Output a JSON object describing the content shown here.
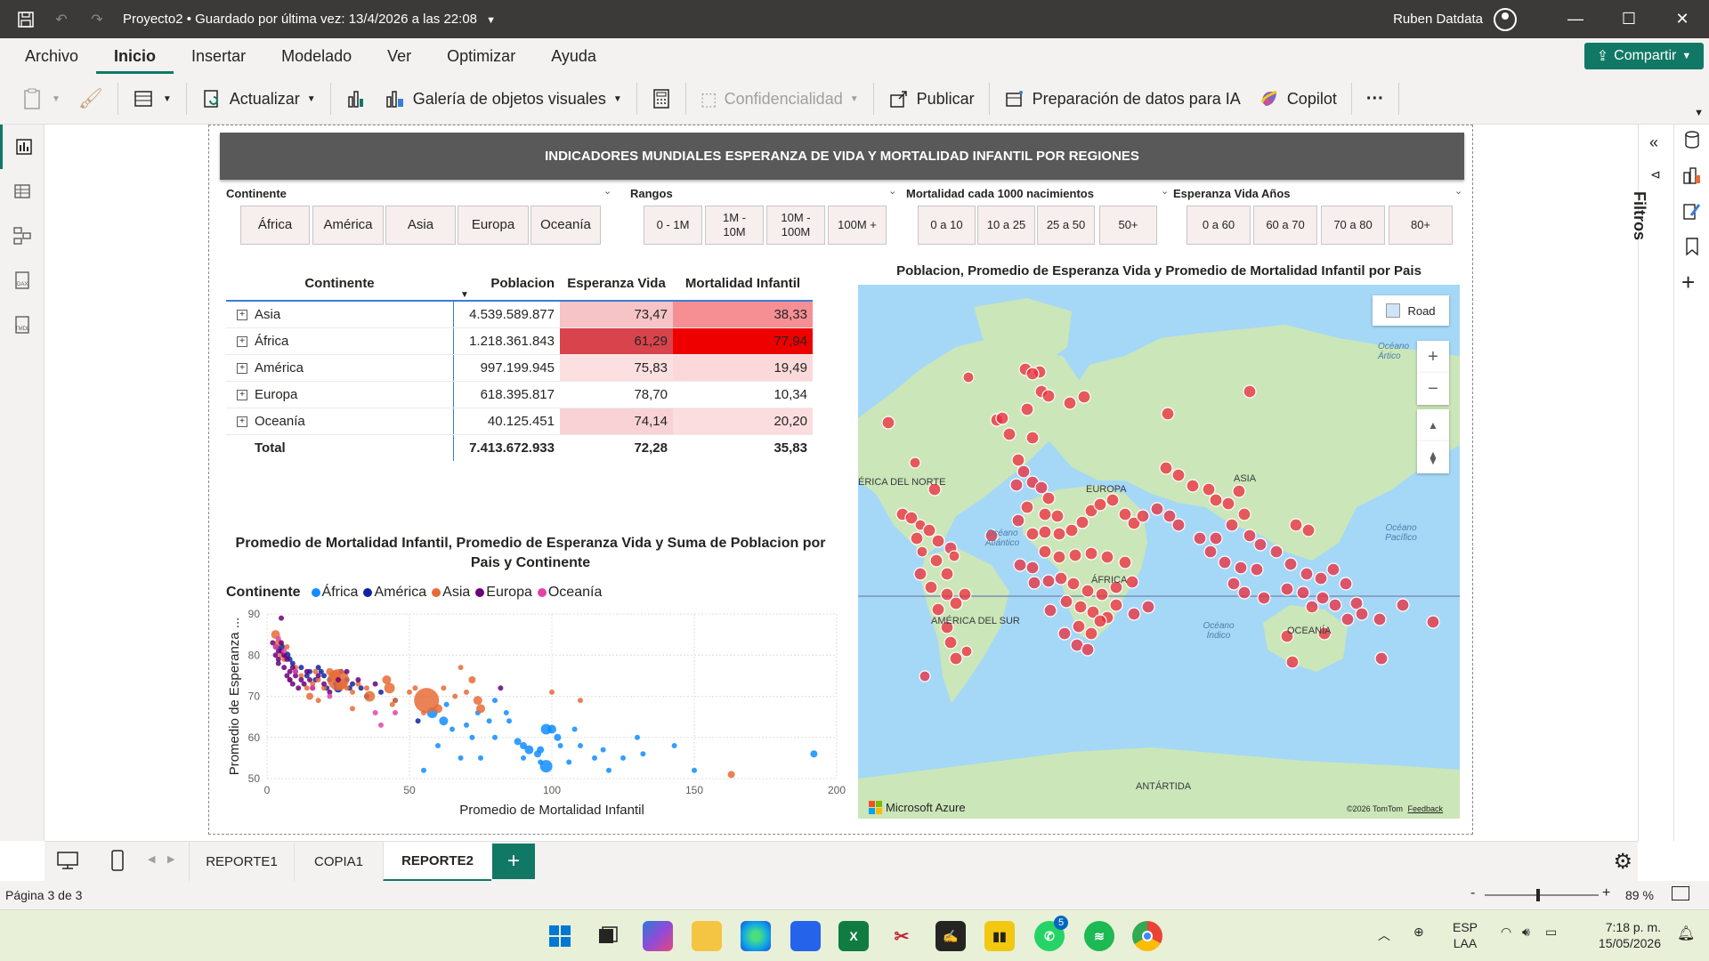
{
  "title_bar": {
    "doc_title": "Proyecto2 • Guardado por última vez: 13/4/2026 a las 22:08",
    "user": "Ruben Datdata"
  },
  "menu": {
    "items": [
      "Archivo",
      "Inicio",
      "Insertar",
      "Modelado",
      "Ver",
      "Optimizar",
      "Ayuda"
    ],
    "active": "Inicio",
    "share": "Compartir"
  },
  "ribbon": {
    "actualizar": "Actualizar",
    "galeria": "Galería de objetos visuales",
    "confidencialidad": "Confidencialidad",
    "publicar": "Publicar",
    "preparacion": "Preparación de datos para IA",
    "copilot": "Copilot",
    "more": "···"
  },
  "right_pane": {
    "filtros": "Filtros"
  },
  "report": {
    "header": "INDICADORES MUNDIALES ESPERANZA DE VIDA Y MORTALIDAD INFANTIL POR REGIONES",
    "slicers": [
      {
        "title": "Continente",
        "options": [
          "África",
          "América",
          "Asia",
          "Europa",
          "Oceanía"
        ]
      },
      {
        "title": "Rangos",
        "options": [
          "0 - 1M",
          "1M - 10M",
          "10M - 100M",
          "100M +"
        ]
      },
      {
        "title": "Mortalidad cada 1000 nacimientos",
        "options": [
          "0 a 10",
          "10 a 25",
          "25 a 50",
          "50+"
        ]
      },
      {
        "title": "Esperanza Vida Años",
        "options": [
          "0 a 60",
          "60 a 70",
          "70 a 80",
          "80+"
        ]
      }
    ],
    "matrix": {
      "headers": [
        "Continente",
        "Poblacion",
        "Esperanza Vida",
        "Mortalidad Infantil"
      ],
      "rows": [
        {
          "name": "Asia",
          "poblacion": "4.539.589.877",
          "esperanza": "73,47",
          "mortalidad": "38,33",
          "esp_bg": "#f6c3c6",
          "mort_bg": "#f58f94"
        },
        {
          "name": "África",
          "poblacion": "1.218.361.843",
          "esperanza": "61,29",
          "mortalidad": "77,94",
          "esp_bg": "#d9434b",
          "mort_bg": "#ee0000"
        },
        {
          "name": "América",
          "poblacion": "997.199.945",
          "esperanza": "75,83",
          "mortalidad": "19,49",
          "esp_bg": "#fbdfe1",
          "mort_bg": "#fbd9db"
        },
        {
          "name": "Europa",
          "poblacion": "618.395.817",
          "esperanza": "78,70",
          "mortalidad": "10,34",
          "esp_bg": "#ffffff",
          "mort_bg": "#ffffff"
        },
        {
          "name": "Oceanía",
          "poblacion": "40.125.451",
          "esperanza": "74,14",
          "mortalidad": "20,20",
          "esp_bg": "#f8d2d5",
          "mort_bg": "#fbdcdf"
        }
      ],
      "total": {
        "name": "Total",
        "poblacion": "7.413.672.933",
        "esperanza": "72,28",
        "mortalidad": "35,83"
      }
    },
    "scatter_title": "Promedio de Mortalidad Infantil, Promedio de Esperanza Vida y Suma de Poblacion por Pais y Continente",
    "legend_label": "Continente",
    "map": {
      "title": "Poblacion, Promedio de Esperanza Vida y Promedio de Mortalidad Infantil por Pais",
      "road": "Road",
      "labels": [
        "ÉRICA DEL NORTE",
        "EUROPA",
        "ASIA",
        "Océano Atlántico",
        "ÁFRICA",
        "AMÉRICA DEL SUR",
        "Océano Índico",
        "OCEANÍA",
        "Océano Pacífico",
        "Océano Ártico",
        "ANTÁRTIDA"
      ],
      "brand": "Microsoft Azure",
      "copyright": "©2026 TomTom",
      "feedback": "Feedback"
    }
  },
  "chart_data": {
    "type": "scatter",
    "title": "Promedio de Mortalidad Infantil, Promedio de Esperanza Vida y Suma de Poblacion por Pais y Continente",
    "xlabel": "Promedio de Mortalidad Infantil",
    "ylabel": "Promedio de Esperanza ...",
    "xlim": [
      0,
      200
    ],
    "ylim": [
      50,
      90
    ],
    "xticks": [
      0,
      50,
      100,
      150,
      200
    ],
    "yticks": [
      50,
      60,
      70,
      80,
      90
    ],
    "grid": true,
    "legend_position": "top-left",
    "series": [
      {
        "name": "África",
        "color": "#118dff",
        "points": [
          [
            58,
            66,
            6
          ],
          [
            62,
            64,
            5
          ],
          [
            60,
            58,
            3
          ],
          [
            65,
            62,
            3
          ],
          [
            70,
            63,
            3
          ],
          [
            72,
            60,
            3
          ],
          [
            75,
            55,
            3
          ],
          [
            68,
            55,
            3
          ],
          [
            78,
            64,
            3
          ],
          [
            80,
            60,
            3
          ],
          [
            85,
            64,
            3
          ],
          [
            88,
            59,
            4
          ],
          [
            90,
            58,
            4
          ],
          [
            92,
            57,
            5
          ],
          [
            95,
            56,
            4
          ],
          [
            96,
            54,
            3
          ],
          [
            98,
            62,
            6
          ],
          [
            100,
            62,
            5
          ],
          [
            102,
            60,
            4
          ],
          [
            103,
            58,
            3
          ],
          [
            98,
            53,
            7
          ],
          [
            108,
            62,
            3
          ],
          [
            110,
            58,
            3
          ],
          [
            115,
            55,
            3
          ],
          [
            118,
            57,
            3
          ],
          [
            120,
            52,
            3
          ],
          [
            125,
            55,
            3
          ],
          [
            132,
            56,
            3
          ],
          [
            130,
            60,
            3
          ],
          [
            143,
            58,
            3
          ],
          [
            150,
            52,
            3
          ],
          [
            192,
            56,
            4
          ],
          [
            55,
            52,
            3
          ],
          [
            63,
            68,
            3
          ],
          [
            74,
            66,
            3
          ],
          [
            80,
            69,
            3
          ],
          [
            96,
            57,
            4
          ],
          [
            106,
            54,
            3
          ],
          [
            84,
            66,
            3
          ],
          [
            90,
            55,
            3
          ]
        ]
      },
      {
        "name": "América",
        "color": "#12239e",
        "points": [
          [
            5,
            82,
            4
          ],
          [
            7,
            80,
            4
          ],
          [
            8,
            79,
            3
          ],
          [
            9,
            78,
            3
          ],
          [
            10,
            76,
            3
          ],
          [
            12,
            77,
            3
          ],
          [
            14,
            75,
            3
          ],
          [
            15,
            76,
            3
          ],
          [
            17,
            74,
            3
          ],
          [
            18,
            77,
            3
          ],
          [
            19,
            76,
            3
          ],
          [
            20,
            75,
            3
          ],
          [
            21,
            72,
            3
          ],
          [
            22,
            74,
            3
          ],
          [
            24,
            73,
            3
          ],
          [
            25,
            72,
            5
          ],
          [
            26,
            76,
            3
          ],
          [
            28,
            74,
            3
          ],
          [
            29,
            72,
            3
          ],
          [
            30,
            73,
            3
          ],
          [
            33,
            72,
            3
          ],
          [
            35,
            70,
            3
          ],
          [
            40,
            71,
            3
          ],
          [
            45,
            69,
            3
          ],
          [
            53,
            64,
            3
          ]
        ]
      },
      {
        "name": "Asia",
        "color": "#e66c37",
        "points": [
          [
            3,
            85,
            5
          ],
          [
            4,
            83,
            4
          ],
          [
            5,
            80,
            3
          ],
          [
            6,
            79,
            3
          ],
          [
            7,
            82,
            3
          ],
          [
            10,
            77,
            3
          ],
          [
            12,
            75,
            3
          ],
          [
            14,
            72,
            3
          ],
          [
            15,
            70,
            4
          ],
          [
            16,
            73,
            3
          ],
          [
            17,
            76,
            3
          ],
          [
            18,
            74,
            3
          ],
          [
            20,
            72,
            3
          ],
          [
            22,
            76,
            4
          ],
          [
            24,
            75,
            6
          ],
          [
            25,
            74,
            12
          ],
          [
            26,
            73,
            6
          ],
          [
            28,
            72,
            3
          ],
          [
            30,
            71,
            3
          ],
          [
            32,
            73,
            3
          ],
          [
            35,
            72,
            3
          ],
          [
            36,
            70,
            6
          ],
          [
            42,
            74,
            5
          ],
          [
            43,
            72,
            6
          ],
          [
            44,
            68,
            3
          ],
          [
            45,
            69,
            3
          ],
          [
            50,
            71,
            3
          ],
          [
            52,
            72,
            3
          ],
          [
            55,
            66,
            3
          ],
          [
            56,
            69,
            14
          ],
          [
            60,
            67,
            5
          ],
          [
            62,
            72,
            3
          ],
          [
            66,
            70,
            3
          ],
          [
            68,
            77,
            3
          ],
          [
            70,
            71,
            3
          ],
          [
            72,
            74,
            4
          ],
          [
            74,
            69,
            5
          ],
          [
            75,
            67,
            5
          ],
          [
            100,
            71,
            3
          ],
          [
            110,
            69,
            3
          ],
          [
            163,
            51,
            4
          ],
          [
            8,
            74,
            3
          ],
          [
            18,
            69,
            3
          ],
          [
            30,
            67,
            3
          ]
        ]
      },
      {
        "name": "Europa",
        "color": "#6b007b",
        "points": [
          [
            2,
            83,
            3
          ],
          [
            3,
            82,
            3
          ],
          [
            3,
            80,
            3
          ],
          [
            4,
            81,
            3
          ],
          [
            4,
            79,
            3
          ],
          [
            4,
            78,
            3
          ],
          [
            5,
            83,
            3
          ],
          [
            5,
            81,
            3
          ],
          [
            6,
            80,
            3
          ],
          [
            6,
            77,
            3
          ],
          [
            7,
            79,
            3
          ],
          [
            7,
            75,
            3
          ],
          [
            8,
            76,
            3
          ],
          [
            8,
            74,
            3
          ],
          [
            9,
            77,
            3
          ],
          [
            9,
            73,
            3
          ],
          [
            10,
            75,
            3
          ],
          [
            11,
            72,
            3
          ],
          [
            12,
            74,
            3
          ],
          [
            13,
            73,
            3
          ],
          [
            14,
            76,
            3
          ],
          [
            15,
            74,
            3
          ],
          [
            16,
            72,
            3
          ],
          [
            18,
            75,
            3
          ],
          [
            20,
            73,
            3
          ],
          [
            22,
            71,
            3
          ],
          [
            25,
            74,
            3
          ],
          [
            28,
            76,
            3
          ],
          [
            32,
            74,
            3
          ],
          [
            38,
            73,
            3
          ],
          [
            5,
            89,
            3
          ],
          [
            82,
            72,
            3
          ]
        ]
      },
      {
        "name": "Oceanía",
        "color": "#e044a7",
        "points": [
          [
            3,
            82,
            3
          ],
          [
            4,
            84,
            3
          ],
          [
            6,
            81,
            3
          ],
          [
            10,
            76,
            3
          ],
          [
            16,
            72,
            3
          ],
          [
            22,
            70,
            3
          ],
          [
            38,
            66,
            3
          ],
          [
            40,
            63,
            3
          ],
          [
            45,
            66,
            3
          ]
        ]
      }
    ]
  },
  "tabs": [
    "REPORTE1",
    "COPIA1",
    "REPORTE2"
  ],
  "active_tab": "REPORTE2",
  "status": {
    "page": "Página 3 de 3",
    "zoom": "89 %"
  },
  "taskbar": {
    "lang1": "ESP",
    "lang2": "LAA",
    "time": "7:18 p. m.",
    "date": "15/05/2026",
    "whatsapp_badge": "5"
  },
  "colors": {
    "accent": "#117865",
    "header_bg": "#595959",
    "map_dot": "#ee2a3b"
  }
}
